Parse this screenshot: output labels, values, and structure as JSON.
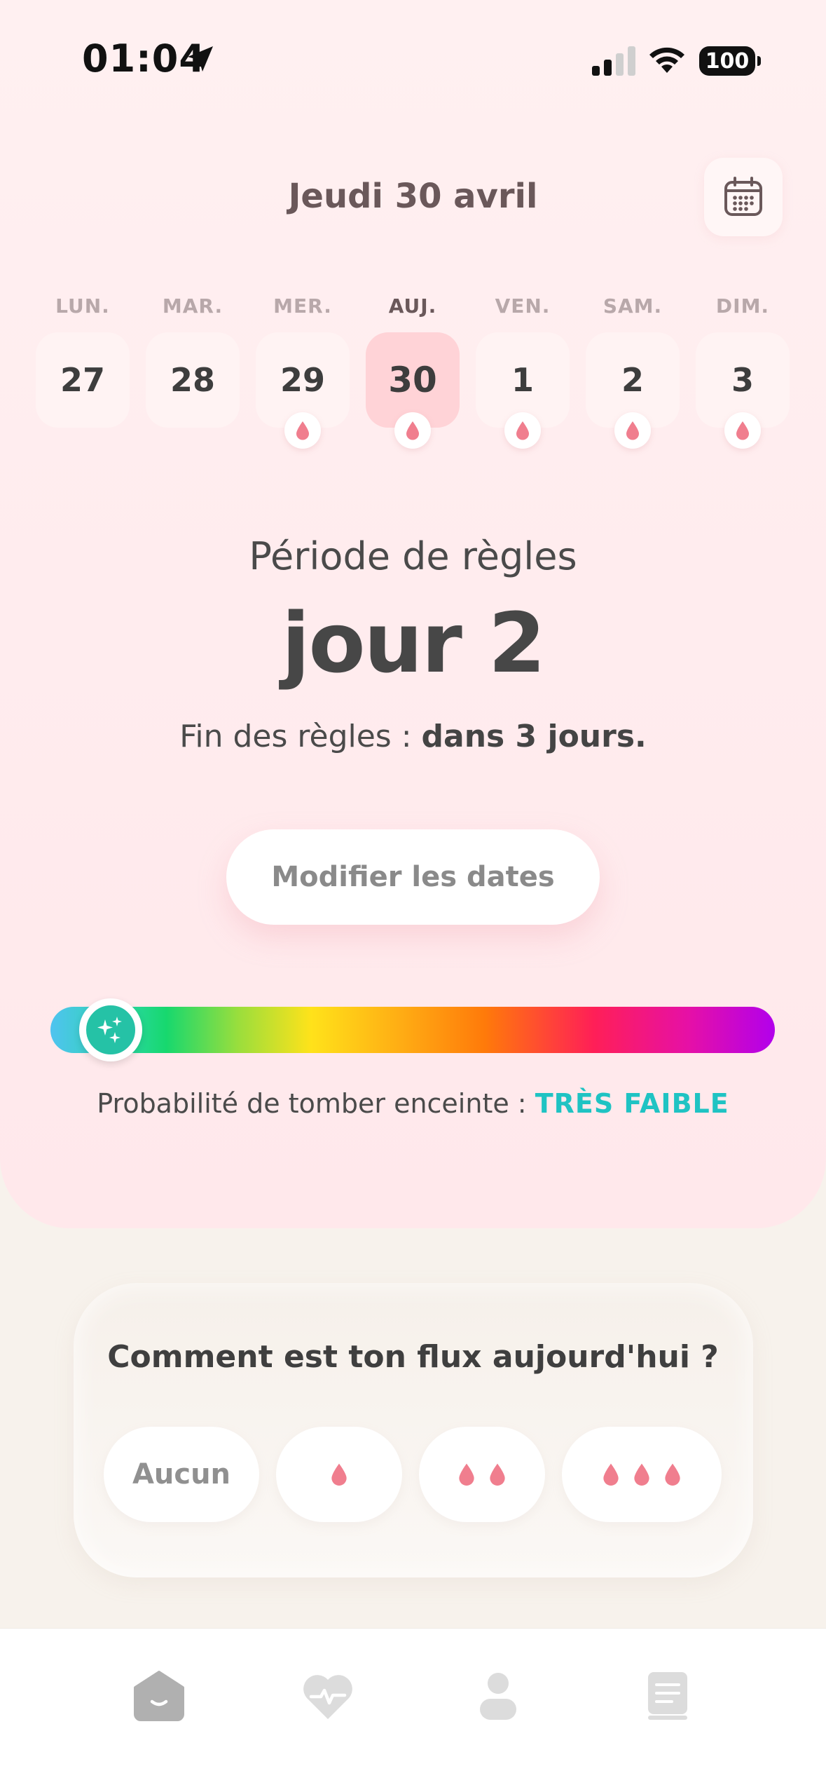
{
  "status_bar": {
    "time": "01:04",
    "battery": "100"
  },
  "header": {
    "date_title": "Jeudi 30 avril"
  },
  "week": [
    {
      "label": "LUN.",
      "day": "27",
      "has_drop": false,
      "today": false
    },
    {
      "label": "MAR.",
      "day": "28",
      "has_drop": false,
      "today": false
    },
    {
      "label": "MER.",
      "day": "29",
      "has_drop": true,
      "today": false
    },
    {
      "label": "AUJ.",
      "day": "30",
      "has_drop": true,
      "today": true
    },
    {
      "label": "VEN.",
      "day": "1",
      "has_drop": true,
      "today": false
    },
    {
      "label": "SAM.",
      "day": "2",
      "has_drop": true,
      "today": false
    },
    {
      "label": "DIM.",
      "day": "3",
      "has_drop": true,
      "today": false
    }
  ],
  "period": {
    "label": "Période de règles",
    "day_text": "jour 2",
    "end_prefix": "Fin des règles : ",
    "end_value": "dans 3 jours."
  },
  "edit_button": "Modifier les dates",
  "probability": {
    "prefix": "Probabilité de tomber enceinte : ",
    "value": "TRÈS FAIBLE",
    "level": 0.05
  },
  "flow": {
    "question": "Comment est ton flux aujourd'hui ?",
    "options": [
      {
        "label": "Aucun",
        "drops": 0
      },
      {
        "label": "",
        "drops": 1
      },
      {
        "label": "",
        "drops": 2
      },
      {
        "label": "",
        "drops": 3
      }
    ]
  },
  "tabs": [
    {
      "icon": "home-icon"
    },
    {
      "icon": "heart-pulse-icon"
    },
    {
      "icon": "profile-icon"
    },
    {
      "icon": "book-icon"
    }
  ],
  "colors": {
    "accent_teal": "#1fc3c3",
    "today_bg": "#ffd3d7",
    "drop": "#f07e8e"
  }
}
